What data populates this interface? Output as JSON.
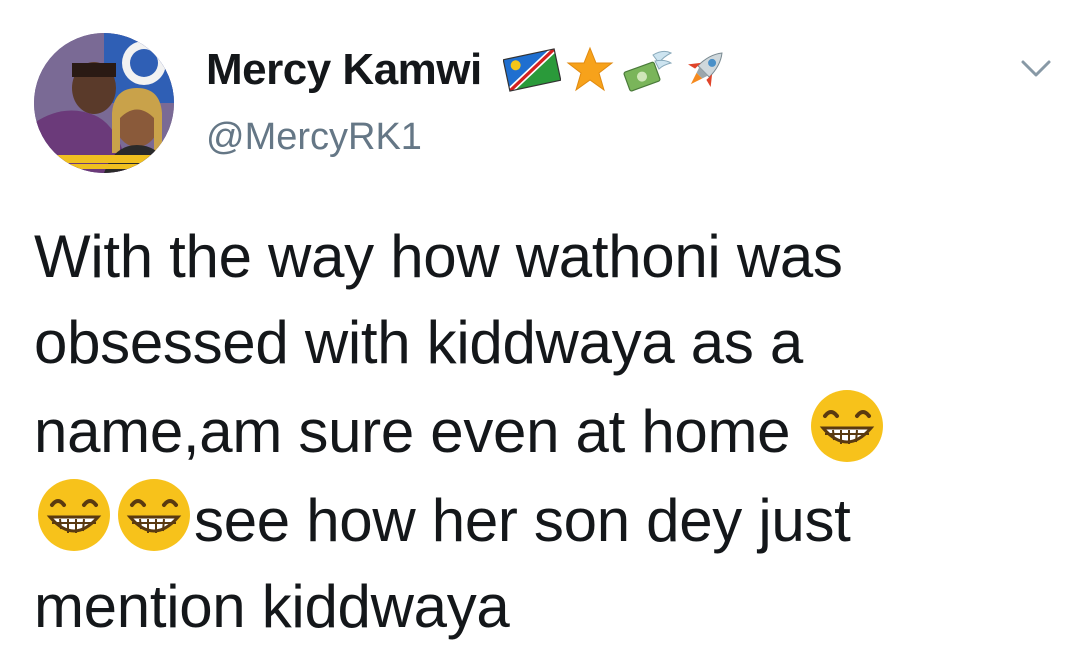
{
  "tweet": {
    "author_name": "Mercy Kamwi",
    "author_handle": "@MercyRK1",
    "name_badges": [
      "namibia-flag-icon",
      "star-icon",
      "money-with-wings-icon",
      "rocket-icon"
    ],
    "text_parts": [
      "With the way how wathoni was obsessed with kiddwaya as a name,am sure even at home ",
      "see how her son dey just mention kiddwaya"
    ],
    "emojis": [
      "laughing-face-icon",
      "laughing-face-icon",
      "laughing-face-icon"
    ]
  },
  "colors": {
    "text": "#14171a",
    "secondary_text": "#657786",
    "background": "#ffffff",
    "emoji_yellow": "#f7c21b"
  }
}
